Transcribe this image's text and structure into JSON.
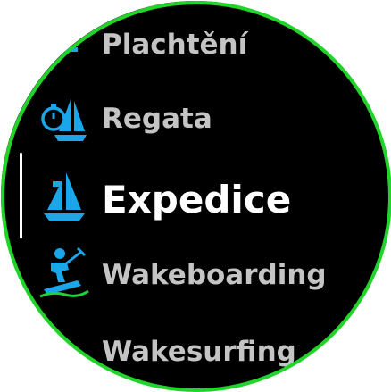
{
  "colors": {
    "background": "#000000",
    "ring": "#22d42a",
    "icon": "#1aa6e8",
    "icon_alt": "#1fd13a",
    "text_normal": "#c4c4c4",
    "text_selected": "#ffffff"
  },
  "menu": {
    "items": [
      {
        "label": "Plachtění",
        "icon": "sailing-icon"
      },
      {
        "label": "Regata",
        "icon": "regatta-icon"
      },
      {
        "label": "Expedice",
        "icon": "expedition-icon",
        "selected": true
      },
      {
        "label": "Wakeboarding",
        "icon": "wakeboarding-icon"
      },
      {
        "label": "Wakesurfing",
        "icon": "wakesurfing-icon"
      }
    ]
  }
}
